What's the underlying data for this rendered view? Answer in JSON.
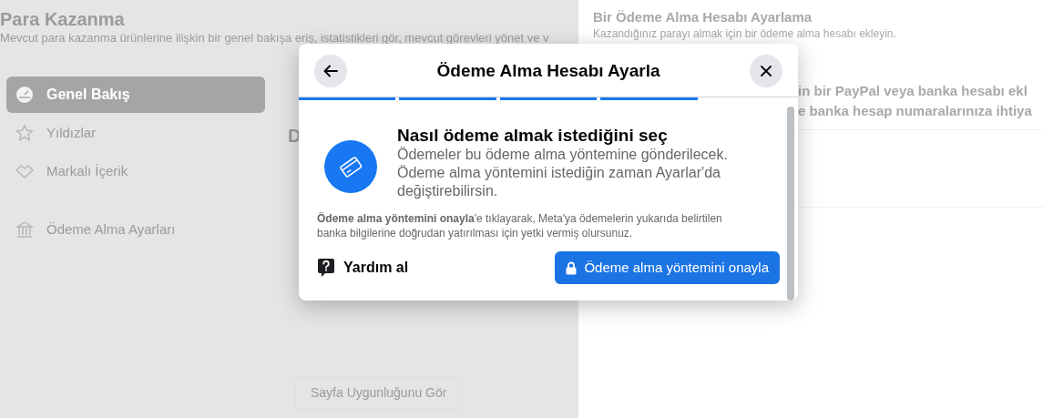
{
  "page": {
    "title": "Para Kazanma",
    "subtitle": "Mevcut para kazanma ürünlerine ilişkin bir genel bakışa eriş, istatistikleri gör, mevcut görevleri yönet ve v",
    "nav": [
      {
        "label": "Genel Bakış",
        "selected": true
      },
      {
        "label": "Yıldızlar",
        "selected": false
      },
      {
        "label": "Markalı İçerik",
        "selected": false
      },
      {
        "label": "Ödeme Alma Ayarları",
        "selected": false
      }
    ],
    "middle_heading": "D",
    "middle_button": "Sayfa Uygunluğunu Gör"
  },
  "right_panel": {
    "title": "Bir Ödeme Alma Hesabı Ayarlama",
    "subtitle": "Kazandığınız parayı almak için bir ödeme alma hesabı ekleyin.",
    "line_1": "in bir PayPal veya banka hesabı ekl",
    "line_2": "e banka hesap numaralarınıza ihtiya"
  },
  "dialog": {
    "title": "Ödeme Alma Hesabı Ayarla",
    "steps": [
      {
        "done": true
      },
      {
        "done": true
      },
      {
        "done": true
      },
      {
        "done": true
      },
      {
        "done": false
      }
    ],
    "heading": "Nasıl ödeme almak istediğini seç",
    "description": "Ödemeler bu ödeme alma yöntemine gönderilecek. Ödeme alma yöntemini istediğin zaman Ayarlar'da değiştirebilirsin.",
    "disclaimer": "**Ödeme alma yöntemini onayla**'e tıklayarak, Meta'ya ödemelerin yukarıda belirtilen banka bilgilerine doğrudan yatırılması için yetki vermiş olursunuz.",
    "help": "Yardım al",
    "confirm_button": "Ödeme alma yöntemini onayla"
  }
}
